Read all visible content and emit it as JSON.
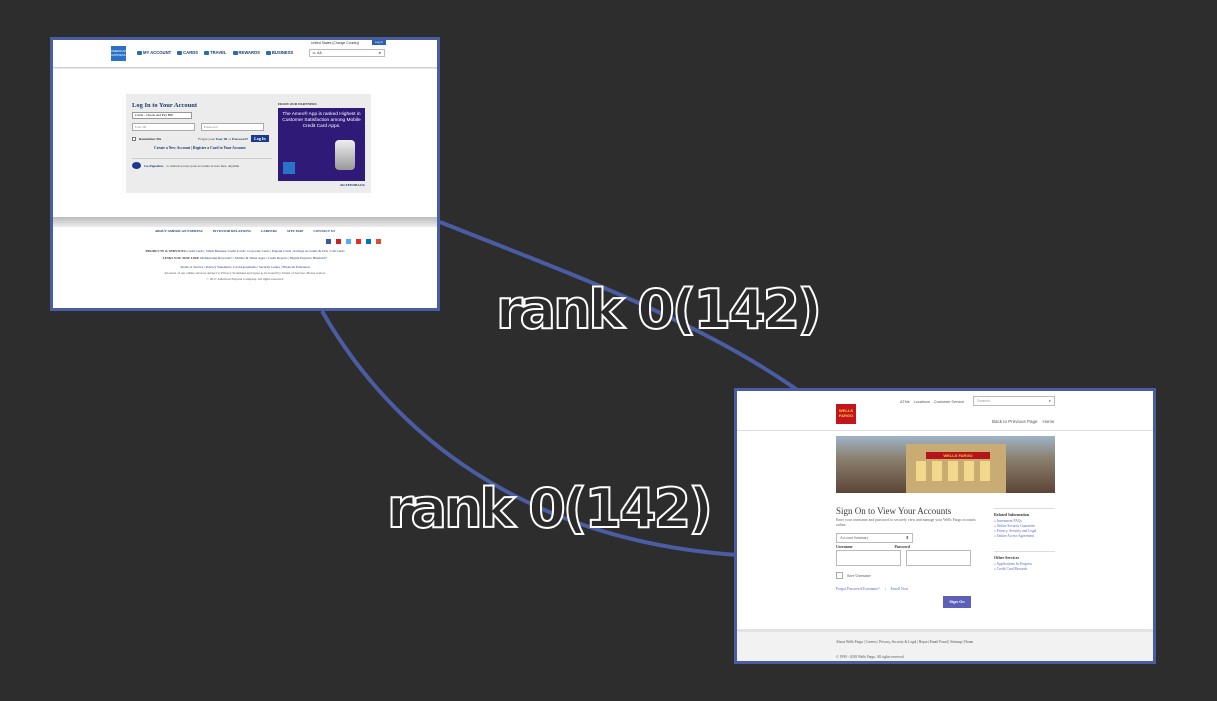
{
  "graph": {
    "edge_label_top": "rank 0(142)",
    "edge_label_bottom": "rank 0(142)",
    "edge_color": "#4a5da3"
  },
  "amex": {
    "logo": "AMERICAN EXPRESS",
    "nav": [
      "MY ACCOUNT",
      "CARDS",
      "TRAVEL",
      "REWARDS",
      "BUSINESS"
    ],
    "country": "United States (Change Country)",
    "login_tab": "Log In",
    "search_icon": "⌕",
    "search_glyphs": "☏  AA",
    "login_title": "Log In to Your Account",
    "select_value": "Cards - Check and Pay Bill",
    "user_id_placeholder": "User ID",
    "password_placeholder": "Password",
    "remember_me": "Remember Me",
    "forgot_prefix": "Forgot your",
    "forgot_userid": "User ID",
    "forgot_or": "or",
    "forgot_password": "Password?",
    "login_button": "Log In",
    "create_account": "Create a New Account",
    "register_card": "Register a Card to Your Account",
    "paperless_title": "Go Paperless",
    "paperless_text": "to unlock access your accounts access fees, anytime",
    "partners_label": "FROM OUR PARTNERS",
    "ad_text": "The Amex® App is ranked Highest in Customer Satisfaction among Mobile Credit Card Apps.",
    "ad_feedback": "AD FEEDBACK",
    "footer_links": [
      "ABOUT AMERICAN EXPRESS",
      "INVESTOR RELATIONS",
      "CAREERS",
      "SITE MAP",
      "CONTACT US"
    ],
    "products_label": "PRODUCTS & SERVICES",
    "products": "Credit Cards | Small Business Credit Cards | Corporate Cards | Prepaid Cards | Savings Accounts & CDs | Gift Cards",
    "links_label": "LINKS YOU MAY LIKE",
    "links": "Membership Rewards® | Mobile & Tablet Apps | Credit Reports | Digital Prepaid | Bluebird®",
    "legal": "Terms of Service | Privacy Statement | Card Agreements | Security Center | Financial Education",
    "disclaimer": "All users of our online services subject to Privacy Statement and agree to be bound by Terms of Service. Please review.",
    "copyright": "© 2017 American Express Company. All rights reserved."
  },
  "wf": {
    "logo": "WELLS FARGO",
    "util_links": [
      "ATMs",
      "Locations",
      "Customer Service"
    ],
    "search_placeholder": "Search",
    "search_icon": "⌕",
    "back_link": "Back to Previous Page",
    "home_link": "Home",
    "hero_sign": "WELLS FARGO",
    "title": "Sign On to View Your Accounts",
    "subtitle": "Enter your username and password to securely view and manage your Wells Fargo accounts online.",
    "dropdown_value": "Account Summary",
    "dropdown_icon": "⬍",
    "username_label": "Username",
    "password_label": "Password",
    "save_username": "Save Username",
    "forgot_link": "Forgot Password/Username?",
    "enroll_link": "Enroll Now",
    "signon_button": "Sign On",
    "related_title": "Related Information",
    "related_items": [
      "» Investment FAQs",
      "» Online Security Guarantee",
      "» Privacy, Security and Legal",
      "» Online Access Agreement"
    ],
    "other_title": "Other Services",
    "other_items": [
      "» Applications In Progress",
      "» Credit Card Rewards"
    ],
    "footer_links": "About Wells Fargo | Careers | Privacy, Security & Legal | Report Email Fraud | Sitemap | Home",
    "footer_copy": "© 1999 - 2018 Wells Fargo. All rights reserved."
  }
}
